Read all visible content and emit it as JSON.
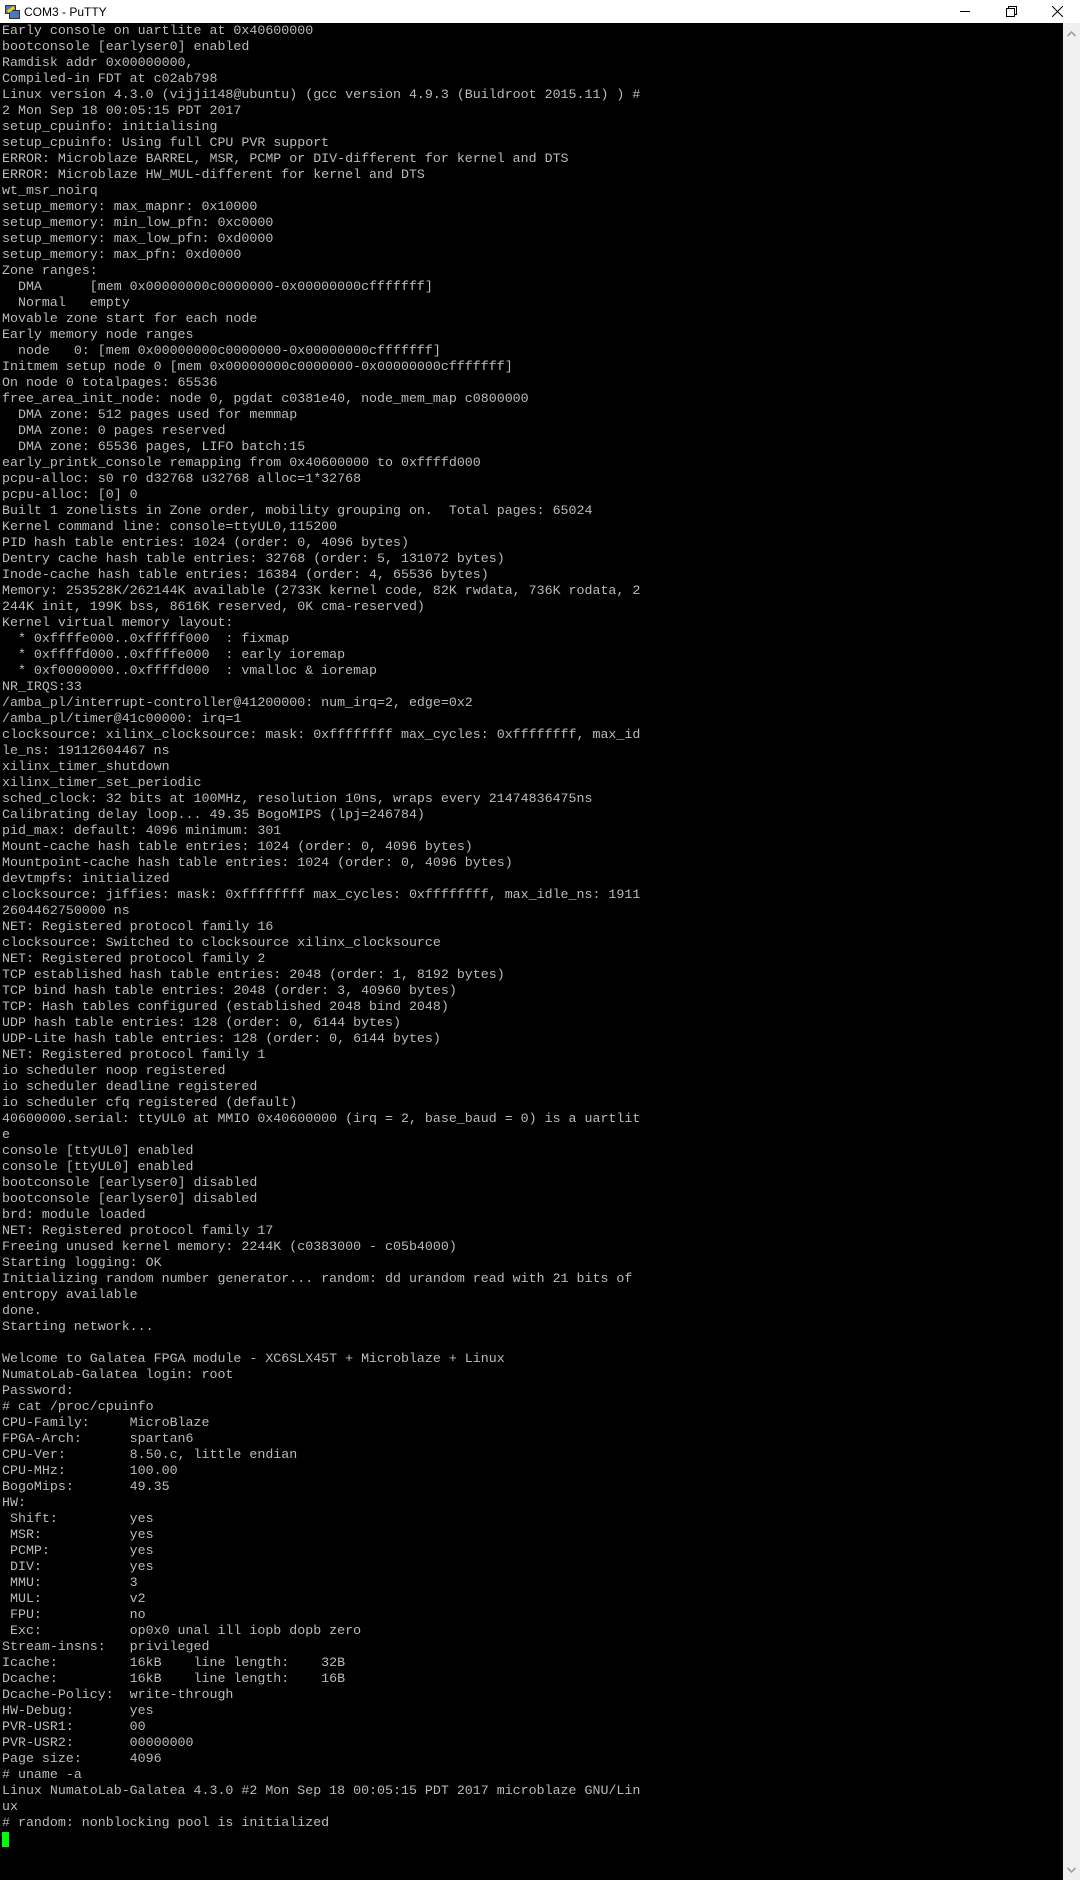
{
  "window": {
    "title": "COM3 - PuTTY",
    "icon": "putty-icon",
    "controls": [
      "minimize",
      "restore",
      "close"
    ]
  },
  "terminal": {
    "text_color": "#bbbbbb",
    "background": "#000000",
    "cursor_color": "#00ff00",
    "lines": [
      "Early console on uartlite at 0x40600000",
      "bootconsole [earlyser0] enabled",
      "Ramdisk addr 0x00000000,",
      "Compiled-in FDT at c02ab798",
      "Linux version 4.3.0 (vijji148@ubuntu) (gcc version 4.9.3 (Buildroot 2015.11) ) #",
      "2 Mon Sep 18 00:05:15 PDT 2017",
      "setup_cpuinfo: initialising",
      "setup_cpuinfo: Using full CPU PVR support",
      "ERROR: Microblaze BARREL, MSR, PCMP or DIV-different for kernel and DTS",
      "ERROR: Microblaze HW_MUL-different for kernel and DTS",
      "wt_msr_noirq",
      "setup_memory: max_mapnr: 0x10000",
      "setup_memory: min_low_pfn: 0xc0000",
      "setup_memory: max_low_pfn: 0xd0000",
      "setup_memory: max_pfn: 0xd0000",
      "Zone ranges:",
      "  DMA      [mem 0x00000000c0000000-0x00000000cfffffff]",
      "  Normal   empty",
      "Movable zone start for each node",
      "Early memory node ranges",
      "  node   0: [mem 0x00000000c0000000-0x00000000cfffffff]",
      "Initmem setup node 0 [mem 0x00000000c0000000-0x00000000cfffffff]",
      "On node 0 totalpages: 65536",
      "free_area_init_node: node 0, pgdat c0381e40, node_mem_map c0800000",
      "  DMA zone: 512 pages used for memmap",
      "  DMA zone: 0 pages reserved",
      "  DMA zone: 65536 pages, LIFO batch:15",
      "early_printk_console remapping from 0x40600000 to 0xffffd000",
      "pcpu-alloc: s0 r0 d32768 u32768 alloc=1*32768",
      "pcpu-alloc: [0] 0",
      "Built 1 zonelists in Zone order, mobility grouping on.  Total pages: 65024",
      "Kernel command line: console=ttyUL0,115200",
      "PID hash table entries: 1024 (order: 0, 4096 bytes)",
      "Dentry cache hash table entries: 32768 (order: 5, 131072 bytes)",
      "Inode-cache hash table entries: 16384 (order: 4, 65536 bytes)",
      "Memory: 253528K/262144K available (2733K kernel code, 82K rwdata, 736K rodata, 2",
      "244K init, 199K bss, 8616K reserved, 0K cma-reserved)",
      "Kernel virtual memory layout:",
      "  * 0xffffe000..0xfffff000  : fixmap",
      "  * 0xffffd000..0xffffe000  : early ioremap",
      "  * 0xf0000000..0xffffd000  : vmalloc & ioremap",
      "NR_IRQS:33",
      "/amba_pl/interrupt-controller@41200000: num_irq=2, edge=0x2",
      "/amba_pl/timer@41c00000: irq=1",
      "clocksource: xilinx_clocksource: mask: 0xffffffff max_cycles: 0xffffffff, max_id",
      "le_ns: 19112604467 ns",
      "xilinx_timer_shutdown",
      "xilinx_timer_set_periodic",
      "sched_clock: 32 bits at 100MHz, resolution 10ns, wraps every 21474836475ns",
      "Calibrating delay loop... 49.35 BogoMIPS (lpj=246784)",
      "pid_max: default: 4096 minimum: 301",
      "Mount-cache hash table entries: 1024 (order: 0, 4096 bytes)",
      "Mountpoint-cache hash table entries: 1024 (order: 0, 4096 bytes)",
      "devtmpfs: initialized",
      "clocksource: jiffies: mask: 0xffffffff max_cycles: 0xffffffff, max_idle_ns: 1911",
      "2604462750000 ns",
      "NET: Registered protocol family 16",
      "clocksource: Switched to clocksource xilinx_clocksource",
      "NET: Registered protocol family 2",
      "TCP established hash table entries: 2048 (order: 1, 8192 bytes)",
      "TCP bind hash table entries: 2048 (order: 3, 40960 bytes)",
      "TCP: Hash tables configured (established 2048 bind 2048)",
      "UDP hash table entries: 128 (order: 0, 6144 bytes)",
      "UDP-Lite hash table entries: 128 (order: 0, 6144 bytes)",
      "NET: Registered protocol family 1",
      "io scheduler noop registered",
      "io scheduler deadline registered",
      "io scheduler cfq registered (default)",
      "40600000.serial: ttyUL0 at MMIO 0x40600000 (irq = 2, base_baud = 0) is a uartlit",
      "e",
      "console [ttyUL0] enabled",
      "console [ttyUL0] enabled",
      "bootconsole [earlyser0] disabled",
      "bootconsole [earlyser0] disabled",
      "brd: module loaded",
      "NET: Registered protocol family 17",
      "Freeing unused kernel memory: 2244K (c0383000 - c05b4000)",
      "Starting logging: OK",
      "Initializing random number generator... random: dd urandom read with 21 bits of",
      "entropy available",
      "done.",
      "Starting network...",
      "",
      "Welcome to Galatea FPGA module - XC6SLX45T + Microblaze + Linux",
      "NumatoLab-Galatea login: root",
      "Password:",
      "# cat /proc/cpuinfo",
      "CPU-Family:     MicroBlaze",
      "FPGA-Arch:      spartan6",
      "CPU-Ver:        8.50.c, little endian",
      "CPU-MHz:        100.00",
      "BogoMips:       49.35",
      "HW:",
      " Shift:         yes",
      " MSR:           yes",
      " PCMP:          yes",
      " DIV:           yes",
      " MMU:           3",
      " MUL:           v2",
      " FPU:           no",
      " Exc:           op0x0 unal ill iopb dopb zero",
      "Stream-insns:   privileged",
      "Icache:         16kB    line length:    32B",
      "Dcache:         16kB    line length:    16B",
      "Dcache-Policy:  write-through",
      "HW-Debug:       yes",
      "PVR-USR1:       00",
      "PVR-USR2:       00000000",
      "Page size:      4096",
      "# uname -a",
      "Linux NumatoLab-Galatea 4.3.0 #2 Mon Sep 18 00:05:15 PDT 2017 microblaze GNU/Lin",
      "ux",
      "# random: nonblocking pool is initialized"
    ]
  }
}
